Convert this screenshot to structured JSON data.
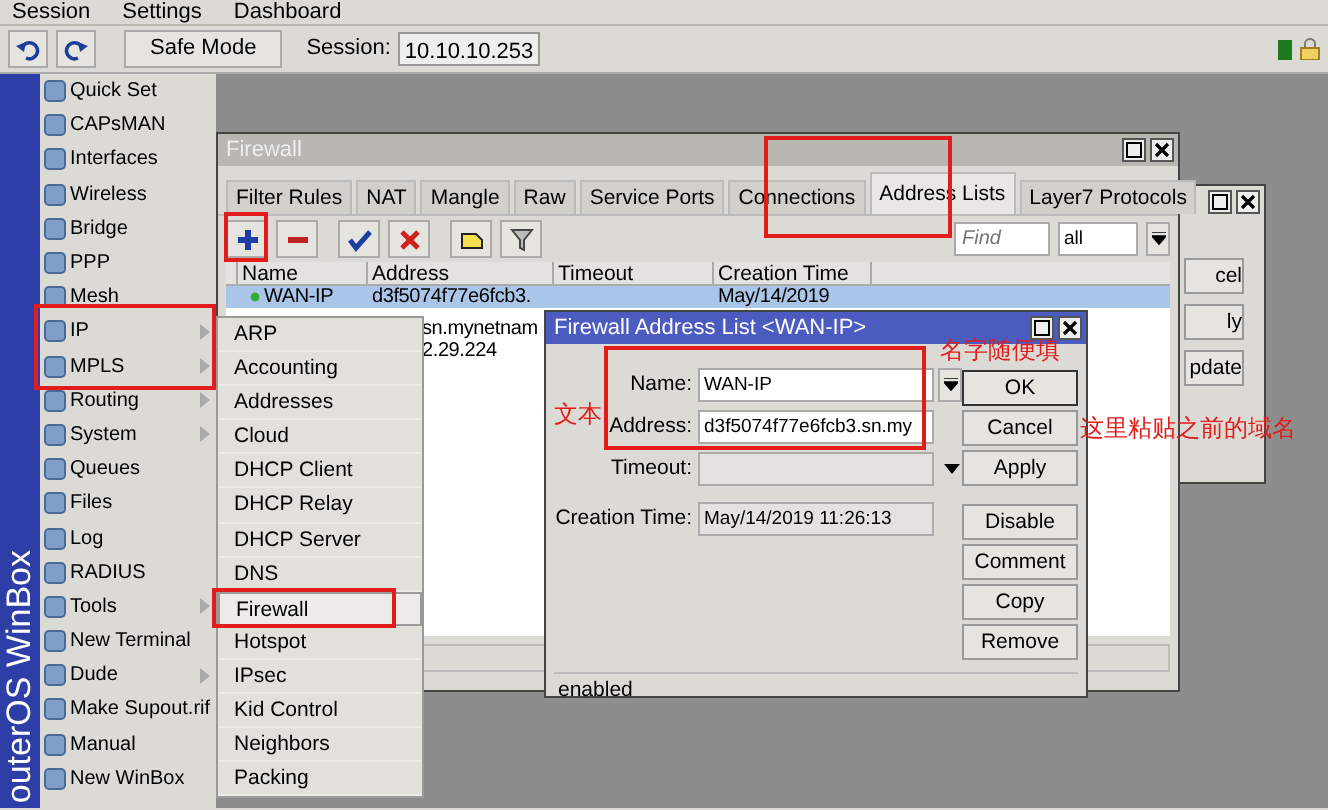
{
  "menubar": [
    "Session",
    "Settings",
    "Dashboard"
  ],
  "toolbar": {
    "safe_mode": "Safe Mode",
    "session_label": "Session:",
    "session_value": "10.10.10.253"
  },
  "brand": "outerOS WinBox",
  "main_menu": [
    {
      "label": "Quick Set",
      "submenu": false
    },
    {
      "label": "CAPsMAN",
      "submenu": false
    },
    {
      "label": "Interfaces",
      "submenu": false
    },
    {
      "label": "Wireless",
      "submenu": false
    },
    {
      "label": "Bridge",
      "submenu": false
    },
    {
      "label": "PPP",
      "submenu": false
    },
    {
      "label": "Mesh",
      "submenu": false
    },
    {
      "label": "IP",
      "submenu": true
    },
    {
      "label": "MPLS",
      "submenu": true
    },
    {
      "label": "Routing",
      "submenu": true
    },
    {
      "label": "System",
      "submenu": true
    },
    {
      "label": "Queues",
      "submenu": false
    },
    {
      "label": "Files",
      "submenu": false
    },
    {
      "label": "Log",
      "submenu": false
    },
    {
      "label": "RADIUS",
      "submenu": false
    },
    {
      "label": "Tools",
      "submenu": true
    },
    {
      "label": "New Terminal",
      "submenu": false
    },
    {
      "label": "Dude",
      "submenu": true
    },
    {
      "label": "Make Supout.rif",
      "submenu": false
    },
    {
      "label": "Manual",
      "submenu": false
    },
    {
      "label": "New WinBox",
      "submenu": false
    }
  ],
  "ip_submenu": [
    {
      "label": "ARP",
      "selected": false
    },
    {
      "label": "Accounting",
      "selected": false
    },
    {
      "label": "Addresses",
      "selected": false
    },
    {
      "label": "Cloud",
      "selected": false
    },
    {
      "label": "DHCP Client",
      "selected": false
    },
    {
      "label": "DHCP Relay",
      "selected": false
    },
    {
      "label": "DHCP Server",
      "selected": false
    },
    {
      "label": "DNS",
      "selected": false
    },
    {
      "label": "Firewall",
      "selected": true
    },
    {
      "label": "Hotspot",
      "selected": false
    },
    {
      "label": "IPsec",
      "selected": false
    },
    {
      "label": "Kid Control",
      "selected": false
    },
    {
      "label": "Neighbors",
      "selected": false
    },
    {
      "label": "Packing",
      "selected": false
    }
  ],
  "firewall": {
    "title": "Firewall",
    "tabs": [
      {
        "label": "Filter Rules",
        "selected": false
      },
      {
        "label": "NAT",
        "selected": false
      },
      {
        "label": "Mangle",
        "selected": false
      },
      {
        "label": "Raw",
        "selected": false
      },
      {
        "label": "Service Ports",
        "selected": false
      },
      {
        "label": "Connections",
        "selected": false
      },
      {
        "label": "Address Lists",
        "selected": true
      },
      {
        "label": "Layer7 Protocols",
        "selected": false
      }
    ],
    "find_placeholder": "Find",
    "filter_value": "all",
    "columns": [
      "Name",
      "Address",
      "Timeout",
      "Creation Time"
    ],
    "rows": [
      {
        "name": "WAN-IP",
        "address": "d3f5074f77e6fcb3.",
        "creation_time": "May/14/2019",
        "selected": true
      },
      {
        "address": "sn.mynetnam",
        "selected": false
      },
      {
        "address": "2.29.224",
        "selected": false
      }
    ]
  },
  "back_window": {
    "buttons": [
      "cel",
      "ly",
      "pdate"
    ]
  },
  "dialog": {
    "title": "Firewall Address List <WAN-IP>",
    "fields": [
      {
        "label": "Name:",
        "value": "WAN-IP",
        "kind": "select"
      },
      {
        "label": "Address:",
        "value": "d3f5074f77e6fcb3.sn.my",
        "kind": "text"
      },
      {
        "label": "Timeout:",
        "kind": "combo"
      },
      {
        "label": "Creation Time:",
        "value": "May/14/2019 11:26:13",
        "kind": "readonly"
      }
    ],
    "buttons": [
      "OK",
      "Cancel",
      "Apply",
      "Disable",
      "Comment",
      "Copy",
      "Remove"
    ],
    "status": "enabled"
  },
  "annotations": [
    "名字随便填",
    "文本",
    "这里粘贴之前的域名"
  ]
}
